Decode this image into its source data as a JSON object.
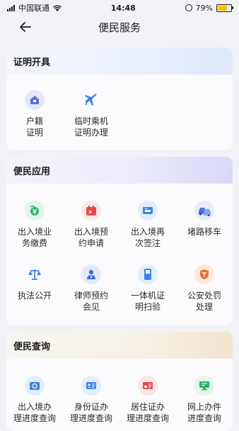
{
  "status": {
    "carrier": "中国联通",
    "time": "14:48",
    "battery": "79%",
    "battery_level": 0.79
  },
  "nav": {
    "title": "便民服务"
  },
  "sections": [
    {
      "title": "证明开具",
      "items": [
        {
          "label": "户籍\n证明",
          "icon": "house-icon"
        },
        {
          "label": "临时乘机\n证明办理",
          "icon": "airplane-icon"
        }
      ]
    },
    {
      "title": "便民应用",
      "items": [
        {
          "label": "出入境业\n务缴费",
          "icon": "money-icon"
        },
        {
          "label": "出入境预\n约申请",
          "icon": "calendar-icon"
        },
        {
          "label": "出入境再\n次签注",
          "icon": "ticket-icon"
        },
        {
          "label": "堵路移车",
          "icon": "car-icon"
        },
        {
          "label": "执法公开",
          "icon": "scale-icon"
        },
        {
          "label": "律师预约\n会见",
          "icon": "lawyer-icon"
        },
        {
          "label": "一体机证\n明扫验",
          "icon": "scanner-icon"
        },
        {
          "label": "公安处罚\n处理",
          "icon": "badge-icon"
        }
      ]
    },
    {
      "title": "便民查询",
      "items": [
        {
          "label": "出入境办\n理进度查询",
          "icon": "passport-icon"
        },
        {
          "label": "身份证办\n理进度查询",
          "icon": "id-card-icon"
        },
        {
          "label": "居住证办\n理进度查询",
          "icon": "residence-card-icon"
        },
        {
          "label": "网上办件\n进度查询",
          "icon": "computer-icon"
        }
      ]
    }
  ]
}
